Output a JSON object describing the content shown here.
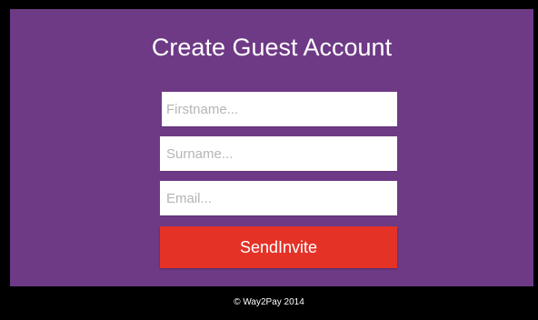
{
  "page": {
    "title": "Create Guest Account",
    "footer": "© Way2Pay 2014"
  },
  "form": {
    "firstname": {
      "value": "",
      "placeholder": "Firstname..."
    },
    "surname": {
      "value": "",
      "placeholder": "Surname..."
    },
    "email": {
      "value": "",
      "placeholder": "Email..."
    },
    "submit_label": "SendInvite"
  },
  "colors": {
    "panel_background": "#6e3a86",
    "page_background": "#000000",
    "button_background": "#e43227",
    "text": "#ffffff"
  }
}
